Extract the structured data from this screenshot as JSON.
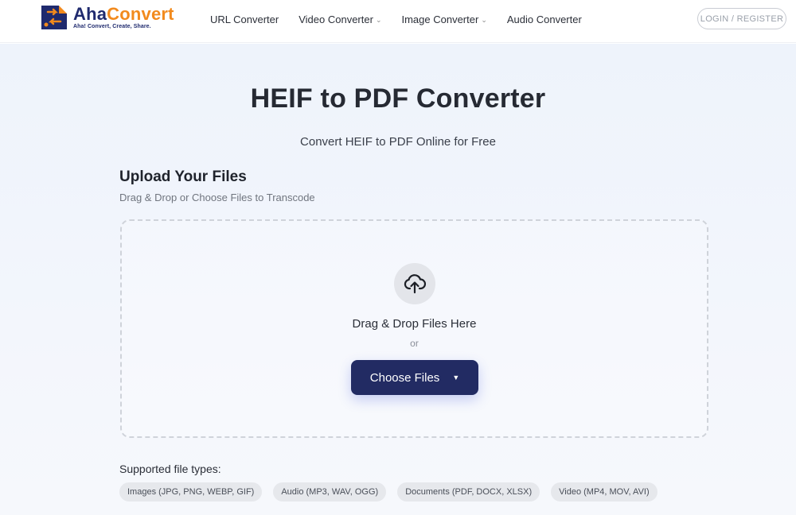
{
  "brand": {
    "name_part1": "Aha",
    "name_part2": "Convert",
    "tagline": "Aha! Convert, Create, Share.",
    "color_primary": "#1f2a6e",
    "color_accent": "#f28a1d"
  },
  "nav": {
    "items": [
      {
        "label": "URL Converter",
        "has_dropdown": false
      },
      {
        "label": "Video Converter",
        "has_dropdown": true
      },
      {
        "label": "Image Converter",
        "has_dropdown": true
      },
      {
        "label": "Audio Converter",
        "has_dropdown": false
      }
    ],
    "chevron_icon": "chevron-down-icon",
    "login_label": "LOGIN / REGISTER"
  },
  "hero": {
    "title": "HEIF to PDF Converter",
    "subtitle": "Convert HEIF to PDF Online for Free"
  },
  "upload": {
    "title": "Upload Your Files",
    "subtitle": "Drag & Drop or Choose Files to Transcode",
    "icon": "cloud-upload-icon",
    "drop_text": "Drag & Drop Files Here",
    "or_text": "or",
    "choose_button_label": "Choose Files",
    "choose_button_caret": "▼",
    "button_color": "#222b63"
  },
  "supported": {
    "label": "Supported file types:",
    "types": [
      "Images (JPG, PNG, WEBP, GIF)",
      "Audio (MP3, WAV, OGG)",
      "Documents (PDF, DOCX, XLSX)",
      "Video (MP4, MOV, AVI)"
    ]
  }
}
